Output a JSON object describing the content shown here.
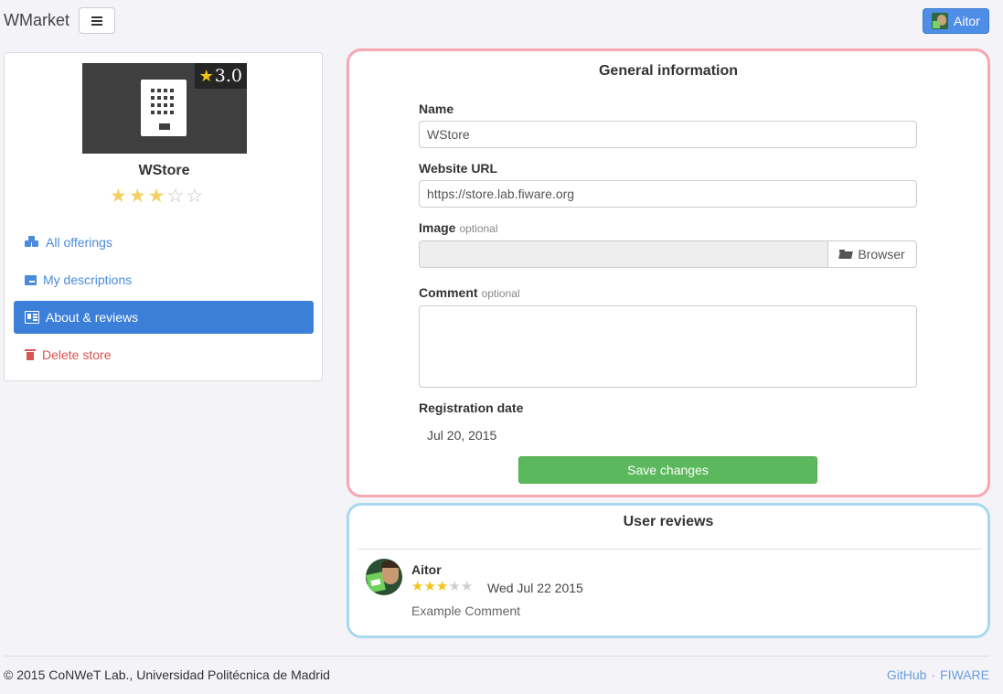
{
  "header": {
    "brand": "WMarket",
    "user_name": "Aitor"
  },
  "sidebar": {
    "store_name": "WStore",
    "thumb_rating": "3.0",
    "rating_stars": 3,
    "rating_max": 5,
    "items": [
      {
        "label": "All offerings",
        "icon": "cubes-icon",
        "active": false
      },
      {
        "label": "My descriptions",
        "icon": "archive-icon",
        "active": false
      },
      {
        "label": "About & reviews",
        "icon": "newspaper-icon",
        "active": true
      },
      {
        "label": "Delete store",
        "icon": "trash-icon",
        "active": false
      }
    ]
  },
  "general_info": {
    "title": "General information",
    "name_label": "Name",
    "name_value": "WStore",
    "url_label": "Website URL",
    "url_value": "https://store.lab.fiware.org",
    "image_label": "Image",
    "optional_text": "optional",
    "browse_label": "Browser",
    "comment_label": "Comment",
    "comment_value": "",
    "registration_label": "Registration date",
    "registration_value": "Jul 20, 2015",
    "save_label": "Save changes"
  },
  "reviews": {
    "title": "User reviews",
    "items": [
      {
        "author": "Aitor",
        "stars": 3,
        "max": 5,
        "date": "Wed Jul 22 2015",
        "comment": "Example Comment"
      }
    ]
  },
  "footer": {
    "copyright": "© 2015 CoNWeT Lab., Universidad Politécnica de Madrid",
    "link_github": "GitHub",
    "separator": "·",
    "link_fiware": "FIWARE"
  },
  "colors": {
    "primary": "#3b7fd9",
    "success": "#5cb85c",
    "danger": "#d9534f",
    "info_panel_outline": "#f5a8b2",
    "reviews_panel_outline": "#a8d8f0"
  }
}
